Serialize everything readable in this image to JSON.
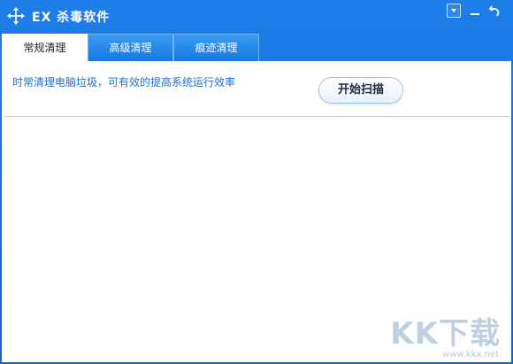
{
  "window": {
    "title": "EX 杀毒软件",
    "icon": "move-arrows-icon"
  },
  "controls": {
    "menu": "dropdown-menu-icon",
    "minimize": "minimize-icon",
    "back": "back-arrow-icon"
  },
  "tabs": [
    {
      "label": "常规清理",
      "active": true
    },
    {
      "label": "高级清理",
      "active": false
    },
    {
      "label": "痕迹清理",
      "active": false
    }
  ],
  "main": {
    "notice": "时常清理电脑垃圾，可有效的提高系统运行效率",
    "scan_button": "开始扫描"
  },
  "watermark": {
    "text": "KK下载",
    "url": "www.kkx.net"
  },
  "colors": {
    "titlebar": "#1e7ee8",
    "accent_text": "#1b6ed8"
  }
}
